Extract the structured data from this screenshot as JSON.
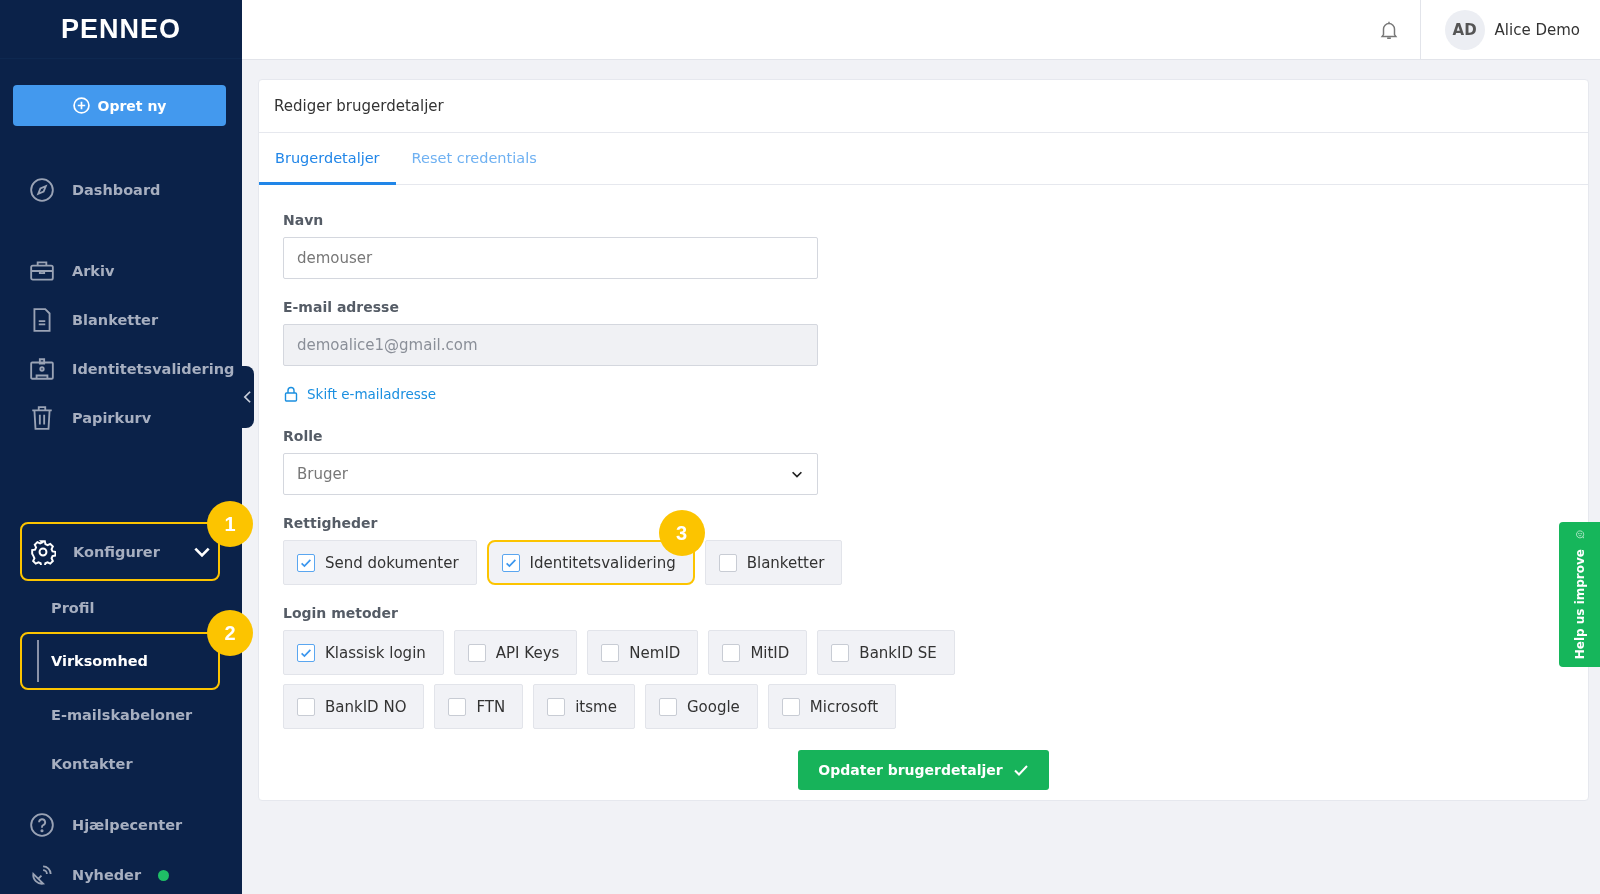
{
  "logo": "PENNEO",
  "create_button": {
    "label": "Opret ny"
  },
  "nav": [
    {
      "label": "Dashboard"
    },
    {
      "label": "Arkiv"
    },
    {
      "label": "Blanketter"
    },
    {
      "label": "Identitetsvalidering"
    },
    {
      "label": "Papirkurv"
    }
  ],
  "config": {
    "label": "Konfigurer",
    "expanded": true,
    "callout": "1",
    "children": [
      {
        "label": "Profil",
        "selected": false
      },
      {
        "label": "Virksomhed",
        "selected": true,
        "callout": "2"
      },
      {
        "label": "E-mailskabeloner",
        "selected": false
      },
      {
        "label": "Kontakter",
        "selected": false
      }
    ]
  },
  "footer_nav": [
    {
      "label": "Hjælpecenter",
      "dot": false
    },
    {
      "label": "Nyheder",
      "dot": true
    }
  ],
  "topbar": {
    "user_initials": "AD",
    "user_name": "Alice Demo"
  },
  "card": {
    "title": "Rediger brugerdetaljer",
    "tabs": [
      {
        "label": "Brugerdetaljer",
        "selected": true
      },
      {
        "label": "Reset credentials",
        "selected": false
      }
    ],
    "name": {
      "label": "Navn",
      "value": "demouser"
    },
    "email": {
      "label": "E-mail adresse",
      "value": "demoalice1@gmail.com",
      "disabled": true
    },
    "change_email": "Skift e-mailadresse",
    "role": {
      "label": "Rolle",
      "value": "Bruger"
    },
    "permissions": {
      "label": "Rettigheder",
      "options": [
        {
          "label": "Send dokumenter",
          "checked": true
        },
        {
          "label": "Identitetsvalidering",
          "checked": true,
          "callout": "3"
        },
        {
          "label": "Blanketter",
          "checked": false
        }
      ]
    },
    "login_methods": {
      "label": "Login metoder",
      "rows": [
        {
          "options": [
            {
              "label": "Klassisk login",
              "checked": true
            },
            {
              "label": "API Keys",
              "checked": false
            },
            {
              "label": "NemID",
              "checked": false
            },
            {
              "label": "MitID",
              "checked": false
            },
            {
              "label": "BankID SE",
              "checked": false
            }
          ]
        },
        {
          "options": [
            {
              "label": "BankID NO",
              "checked": false
            },
            {
              "label": "FTN",
              "checked": false
            },
            {
              "label": "itsme",
              "checked": false
            },
            {
              "label": "Google",
              "checked": false
            },
            {
              "label": "Microsoft",
              "checked": false
            }
          ]
        }
      ]
    },
    "submit": "Opdater brugerdetaljer"
  },
  "feedback_tab": "Help us improve"
}
